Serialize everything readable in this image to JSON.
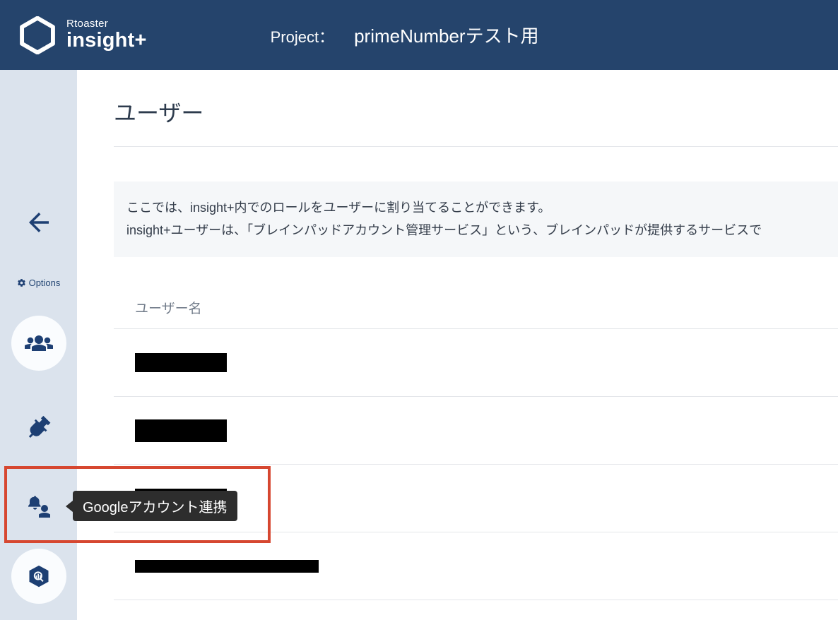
{
  "brand": {
    "small": "Rtoaster",
    "big": "insight+"
  },
  "header": {
    "project_label": "Project：",
    "project_name": "primeNumberテスト用"
  },
  "sidebar": {
    "options_label": "Options",
    "tooltip": "Googleアカウント連携",
    "items": {
      "back": "back-arrow",
      "users": "users-icon",
      "plug": "plug-icon",
      "bell": "bell-person-icon",
      "bq": "bigquery-icon"
    }
  },
  "page": {
    "title": "ユーザー",
    "info_line1": "ここでは、insight+内でのロールをユーザーに割り当てることができます。",
    "info_line2": "insight+ユーザーは、「ブレインパッドアカウント管理サービス」という、ブレインパッドが提供するサービスで",
    "column_header": "ユーザー名",
    "rows": [
      {
        "name_redacted": true
      },
      {
        "name_redacted": true
      },
      {
        "name_redacted": true
      },
      {
        "name_redacted": true
      }
    ]
  }
}
